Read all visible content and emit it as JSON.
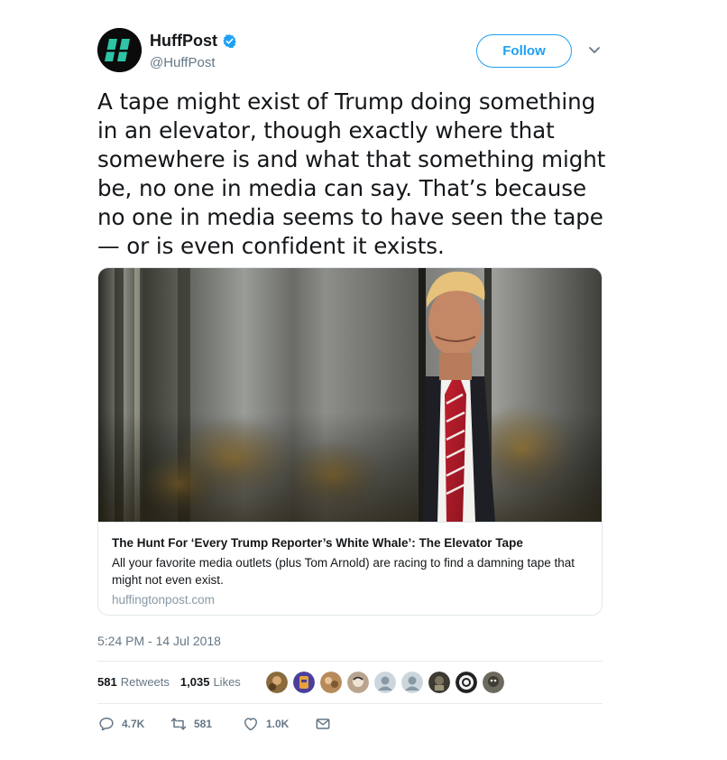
{
  "author": {
    "name": "HuffPost",
    "handle": "@HuffPost",
    "verified": true,
    "avatar_icon": "huffpost-logo-icon",
    "logo_color": "#2ec4a5"
  },
  "follow_button": {
    "label": "Follow",
    "color": "#1da1f2"
  },
  "tweet": {
    "text": "A tape might exist of Trump doing something\nin an elevator, though exactly where that\nsomewhere is and what that something might\nbe, no one in media can say. That’s because\nno one in media seems to have seen the tape\n— or is even confident it exists."
  },
  "card": {
    "image_icon": "elevator-photo-icon",
    "title": "The Hunt For ‘Every Trump Reporter’s White Whale’: The Elevator Tape",
    "description": "All your favorite media outlets (plus Tom Arnold) are racing to find a damning tape that might not even exist.",
    "domain": "huffingtonpost.com"
  },
  "timestamp": "5:24 PM - 14 Jul 2018",
  "stats": {
    "retweets_count": "581",
    "retweets_label": "Retweets",
    "likes_count": "1,035",
    "likes_label": "Likes"
  },
  "likers": [
    {
      "icon": "avatar-1-icon",
      "color": "#8a6b3e"
    },
    {
      "icon": "avatar-2-icon",
      "color": "#4a3f9a"
    },
    {
      "icon": "avatar-3-icon",
      "color": "#b88a5a"
    },
    {
      "icon": "avatar-4-icon",
      "color": "#b9a58e"
    },
    {
      "icon": "default-avatar-icon",
      "color": "#ccd6dd"
    },
    {
      "icon": "default-avatar-icon",
      "color": "#ccd6dd"
    },
    {
      "icon": "avatar-7-icon",
      "color": "#3d3a33"
    },
    {
      "icon": "avatar-8-icon",
      "color": "#222222"
    },
    {
      "icon": "avatar-9-icon",
      "color": "#6c6a5e"
    }
  ],
  "actions": {
    "reply_count": "4.7K",
    "retweet_count": "581",
    "like_count": "1.0K"
  },
  "colors": {
    "text_primary": "#14171a",
    "text_secondary": "#657786",
    "border": "#e1e8ed",
    "accent": "#1da1f2"
  }
}
